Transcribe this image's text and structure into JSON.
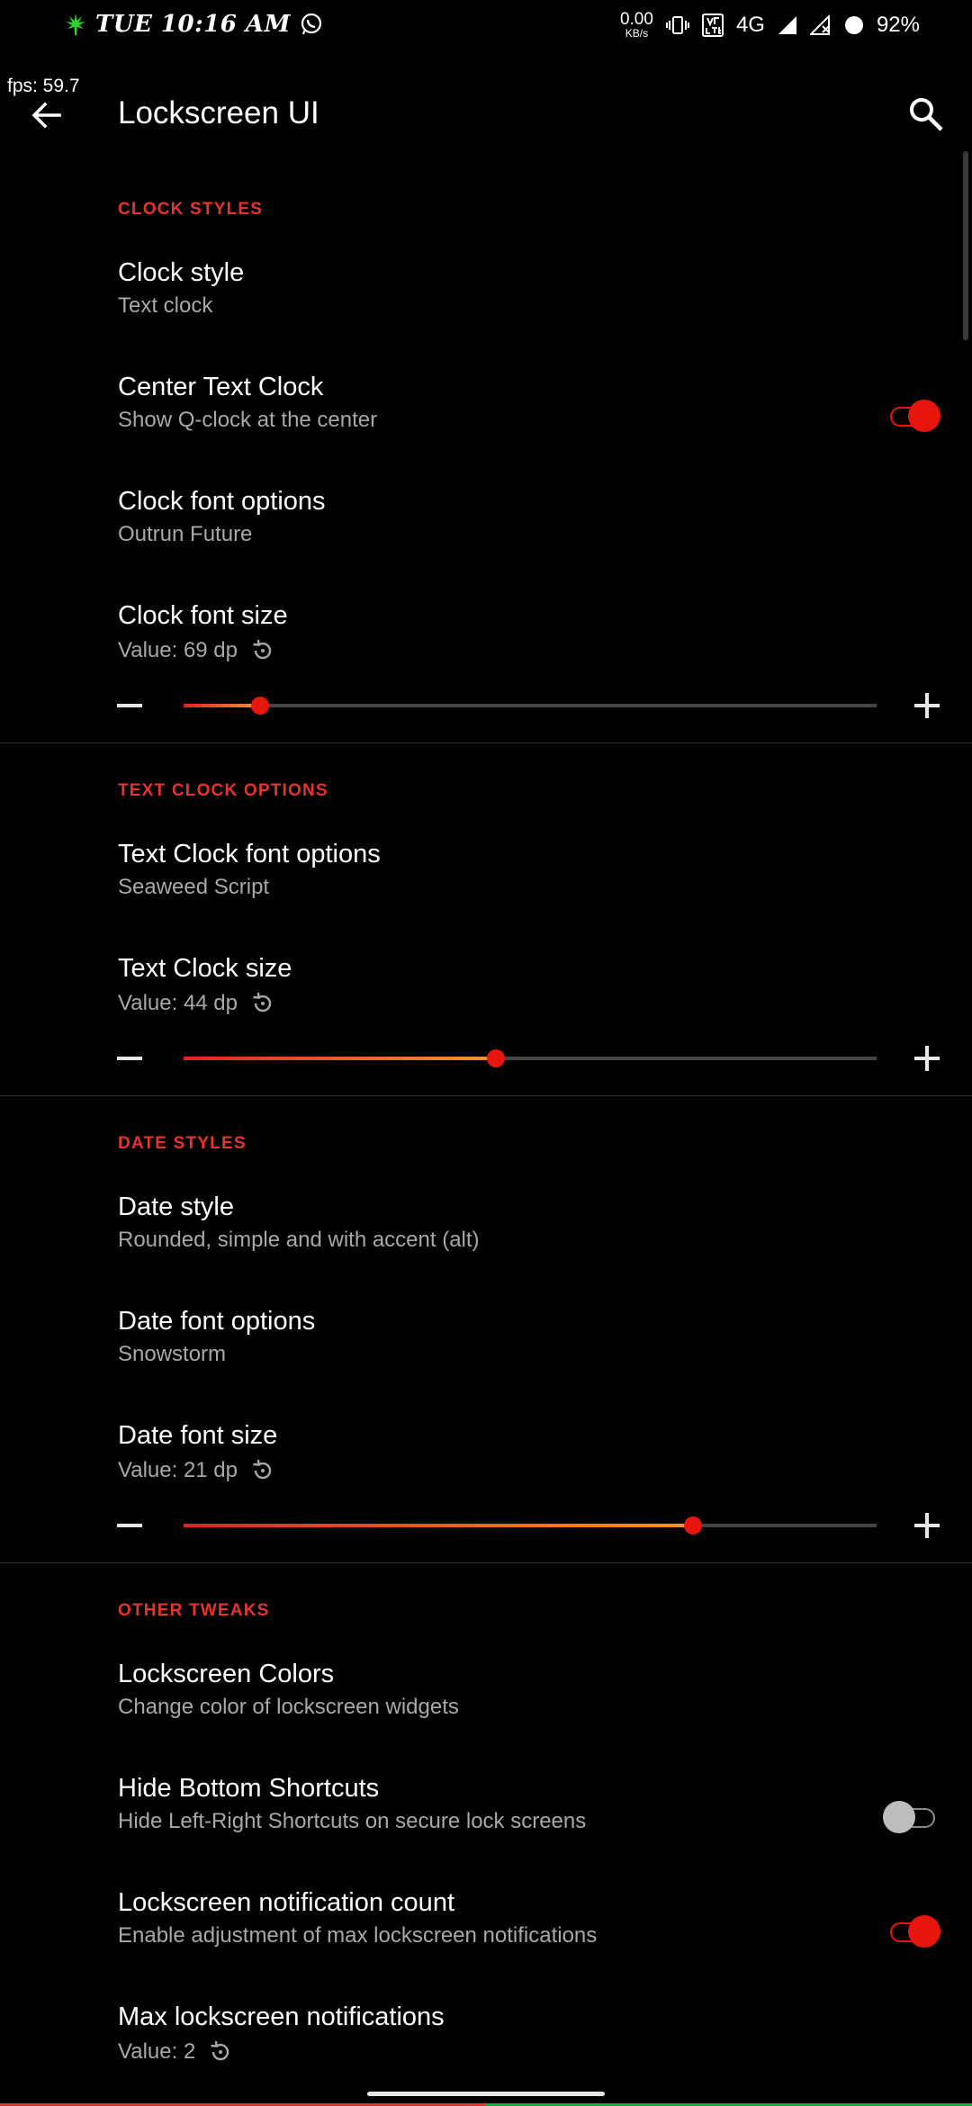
{
  "status_bar": {
    "time": "TUE 10:16 AM",
    "net_speed_value": "0.00",
    "net_speed_unit": "KB/s",
    "network": "4G",
    "battery": "92%",
    "icons": [
      "cannabis-leaf-icon",
      "whatsapp-icon",
      "vibrate-icon",
      "volte-icon",
      "signal-icon",
      "signal-off-icon",
      "battery-icon"
    ]
  },
  "overlay": {
    "fps": "fps: 59.7"
  },
  "app_bar": {
    "title": "Lockscreen UI"
  },
  "accent_color": "#e8332a",
  "sections": [
    {
      "header": "CLOCK STYLES",
      "items": [
        {
          "title": "Clock style",
          "summary": "Text clock"
        },
        {
          "title": "Center Text Clock",
          "summary": "Show Q-clock at the center",
          "toggle": true
        },
        {
          "title": "Clock font options",
          "summary": "Outrun Future"
        },
        {
          "title": "Clock font size",
          "value": "Value: 69 dp",
          "slider_fraction": 0.11
        }
      ]
    },
    {
      "header": "TEXT CLOCK OPTIONS",
      "items": [
        {
          "title": "Text Clock font options",
          "summary": "Seaweed Script"
        },
        {
          "title": "Text Clock size",
          "value": "Value: 44 dp",
          "slider_fraction": 0.45
        }
      ]
    },
    {
      "header": "DATE STYLES",
      "items": [
        {
          "title": "Date style",
          "summary": "Rounded, simple and with accent (alt)"
        },
        {
          "title": "Date font options",
          "summary": "Snowstorm"
        },
        {
          "title": "Date font size",
          "value": "Value: 21 dp",
          "slider_fraction": 0.735
        }
      ]
    },
    {
      "header": "OTHER TWEAKS",
      "items": [
        {
          "title": "Lockscreen Colors",
          "summary": "Change color of lockscreen widgets"
        },
        {
          "title": "Hide Bottom Shortcuts",
          "summary": "Hide Left-Right Shortcuts on secure lock screens",
          "toggle": false
        },
        {
          "title": "Lockscreen notification count",
          "summary": "Enable adjustment of max lockscreen notifications",
          "toggle": true
        },
        {
          "title": "Max lockscreen notifications",
          "value": "Value: 2"
        }
      ]
    }
  ]
}
